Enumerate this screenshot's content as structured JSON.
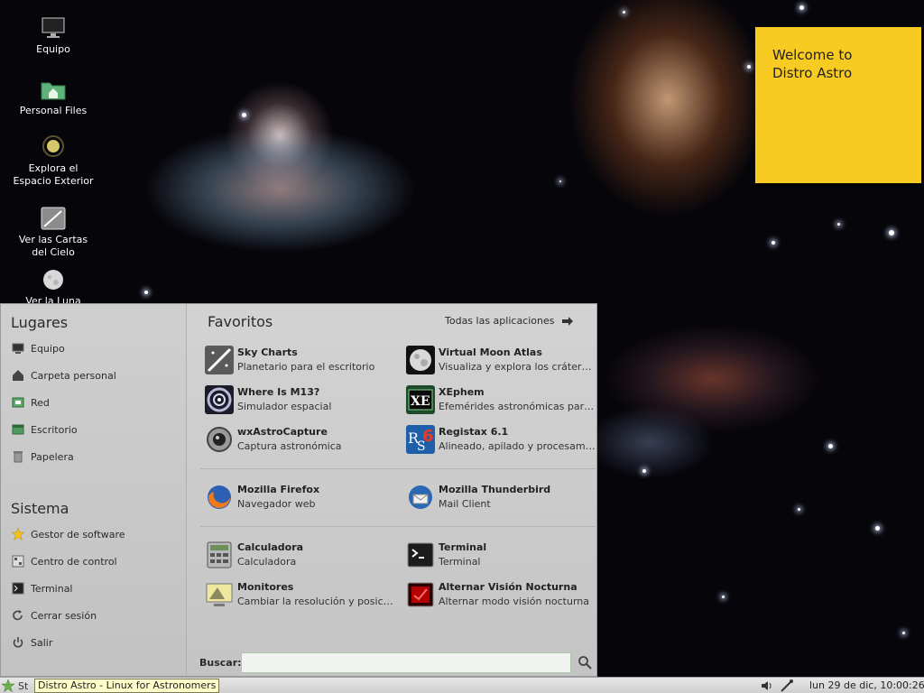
{
  "desktop": {
    "icons": [
      {
        "label": "Equipo",
        "icon": "monitor-icon"
      },
      {
        "label": "Personal Files",
        "icon": "home-folder-icon"
      },
      {
        "label": "Explora el\nEspacio Exterior",
        "icon": "space-icon"
      },
      {
        "label": "Ver las Cartas\ndel Cielo",
        "icon": "sky-chart-icon"
      },
      {
        "label": "Ver la Luna",
        "icon": "moon-icon"
      }
    ],
    "sticky_note": "Welcome to\nDistro Astro"
  },
  "menu": {
    "places_title": "Lugares",
    "places": [
      {
        "label": "Equipo",
        "icon": "monitor-icon"
      },
      {
        "label": "Carpeta personal",
        "icon": "home-icon"
      },
      {
        "label": "Red",
        "icon": "network-icon"
      },
      {
        "label": "Escritorio",
        "icon": "desktop-icon"
      },
      {
        "label": "Papelera",
        "icon": "trash-icon"
      }
    ],
    "system_title": "Sistema",
    "system": [
      {
        "label": "Gestor de software",
        "icon": "star-icon"
      },
      {
        "label": "Centro de control",
        "icon": "control-center-icon"
      },
      {
        "label": "Terminal",
        "icon": "terminal-icon"
      },
      {
        "label": "Cerrar sesión",
        "icon": "logout-icon"
      },
      {
        "label": "Salir",
        "icon": "power-icon"
      }
    ],
    "favorites_title": "Favoritos",
    "all_apps_label": "Todas las aplicaciones",
    "apps": [
      {
        "name": "Sky Charts",
        "desc": "Planetario para el escritorio",
        "icon": "sky-charts-icon"
      },
      {
        "name": "Virtual Moon Atlas",
        "desc": "Visualiza y explora los cráter…",
        "icon": "moon-atlas-icon"
      },
      {
        "name": "Where Is M13?",
        "desc": "Simulador espacial",
        "icon": "galaxy-icon"
      },
      {
        "name": "XEphem",
        "desc": "Efemérides astronómicas par…",
        "icon": "xephem-icon"
      },
      {
        "name": "wxAstroCapture",
        "desc": "Captura astronómica",
        "icon": "webcam-icon"
      },
      {
        "name": "Registax 6.1",
        "desc": "Alineado, apilado y procesam…",
        "icon": "registax-icon"
      },
      {
        "name": "Mozilla Firefox",
        "desc": "Navegador web",
        "icon": "firefox-icon"
      },
      {
        "name": "Mozilla Thunderbird",
        "desc": "Mail Client",
        "icon": "thunderbird-icon"
      },
      {
        "name": "Calculadora",
        "desc": "Calculadora",
        "icon": "calculator-icon"
      },
      {
        "name": "Terminal",
        "desc": "Terminal",
        "icon": "terminal-icon"
      },
      {
        "name": "Monitores",
        "desc": "Cambiar la resolución y posic…",
        "icon": "display-icon"
      },
      {
        "name": "Alternar Visión Nocturna",
        "desc": "Alternar modo visión nocturna",
        "icon": "night-vision-icon"
      }
    ],
    "search_label": "Buscar:",
    "search_value": ""
  },
  "taskbar": {
    "start_label": "St",
    "tooltip": "Distro Astro - Linux for Astronomers",
    "clock": "lun 29 de dic, 10:00:26"
  },
  "colors": {
    "sticky": "#f8cb22",
    "menu_bg": "#c8c8c8",
    "desktop_bg": "#06050a"
  }
}
